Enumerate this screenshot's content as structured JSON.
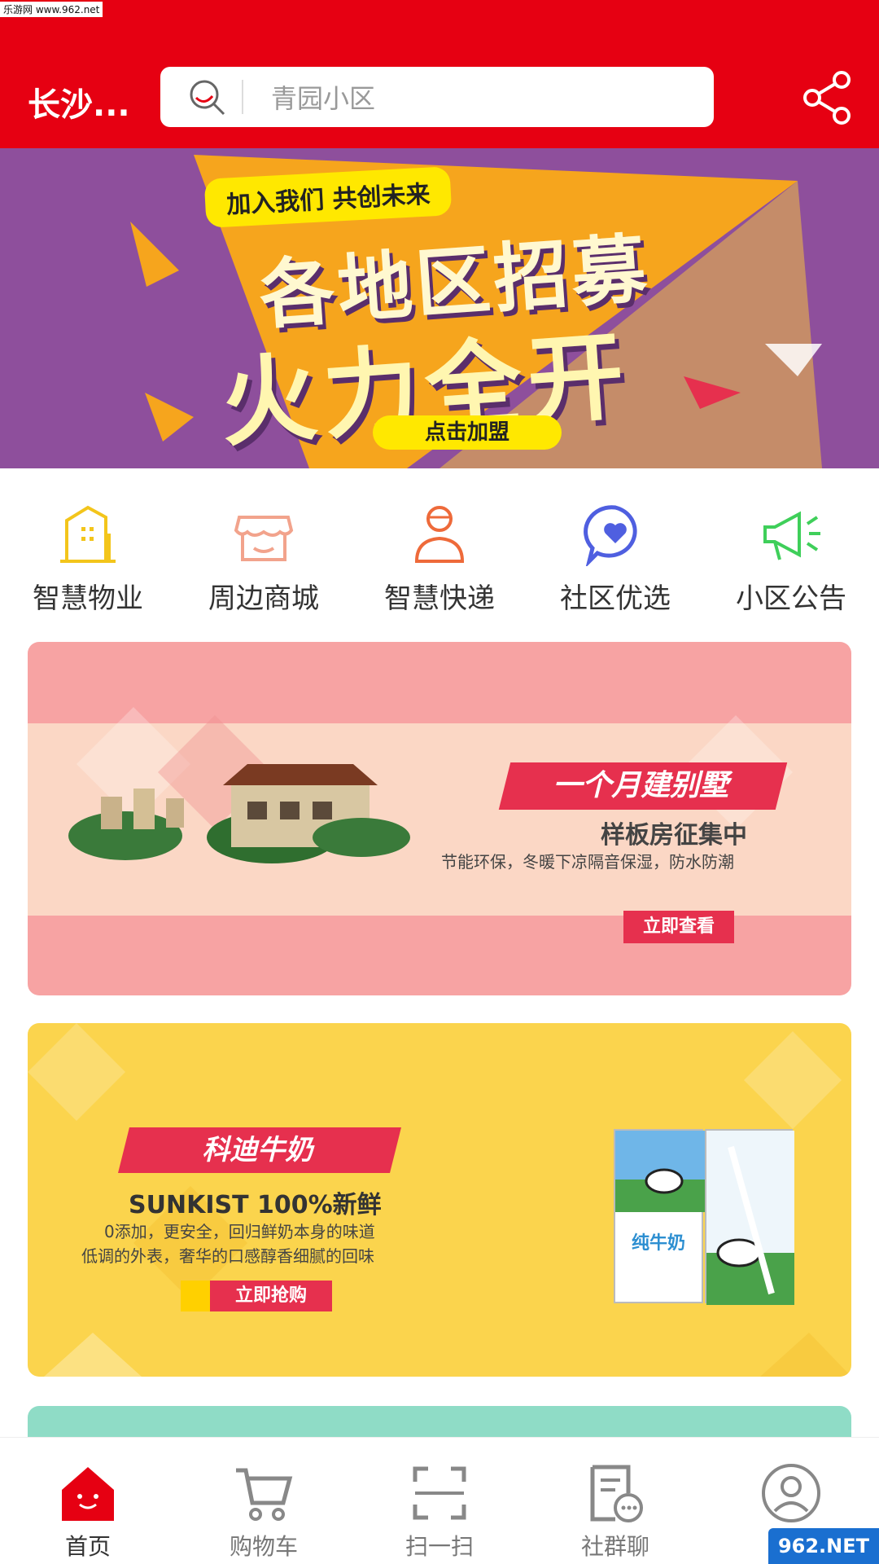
{
  "watermark": "乐游网 www.962.net",
  "header": {
    "city": "长沙...",
    "search_placeholder": "青园小区",
    "icons": {
      "search": "search-icon",
      "share": "share-icon"
    }
  },
  "banner": {
    "tag": "加入我们 共创未来",
    "line1": "各地区招募",
    "line2": "火力全开",
    "cta": "点击加盟"
  },
  "nav": [
    {
      "label": "智慧物业",
      "icon": "building-icon",
      "color": "#f3c51b"
    },
    {
      "label": "周边商城",
      "icon": "shop-icon",
      "color": "#f2a38c"
    },
    {
      "label": "智慧快递",
      "icon": "courier-icon",
      "color": "#ee6a3a"
    },
    {
      "label": "社区优选",
      "icon": "heart-chat-icon",
      "color": "#4f5fe0"
    },
    {
      "label": "小区公告",
      "icon": "megaphone-icon",
      "color": "#3fcf5a"
    }
  ],
  "promo1": {
    "title": "一个月建别墅",
    "sub": "样板房征集中",
    "desc": "节能环保，冬暖下凉隔音保湿，防水防潮",
    "button": "立即查看"
  },
  "promo2": {
    "title": "科迪牛奶",
    "sub": "SUNKIST 100%新鲜",
    "desc1": "0添加，更安全，回归鲜奶本身的味道",
    "desc2": "低调的外表，奢华的口感醇香细腻的回味",
    "button": "立即抢购",
    "product_text": "纯牛奶"
  },
  "tabbar": [
    {
      "label": "首页",
      "icon": "home-icon",
      "active": true
    },
    {
      "label": "购物车",
      "icon": "cart-icon",
      "active": false
    },
    {
      "label": "扫一扫",
      "icon": "scan-icon",
      "active": false
    },
    {
      "label": "社群聊",
      "icon": "chat-icon",
      "active": false
    },
    {
      "label": "",
      "icon": "profile-icon",
      "active": false
    }
  ],
  "corner_watermark": "962.NET",
  "colors": {
    "brand_red": "#e60012",
    "accent_red": "#e6304e",
    "yellow": "#ffe800",
    "purple": "#8e4f9c"
  }
}
